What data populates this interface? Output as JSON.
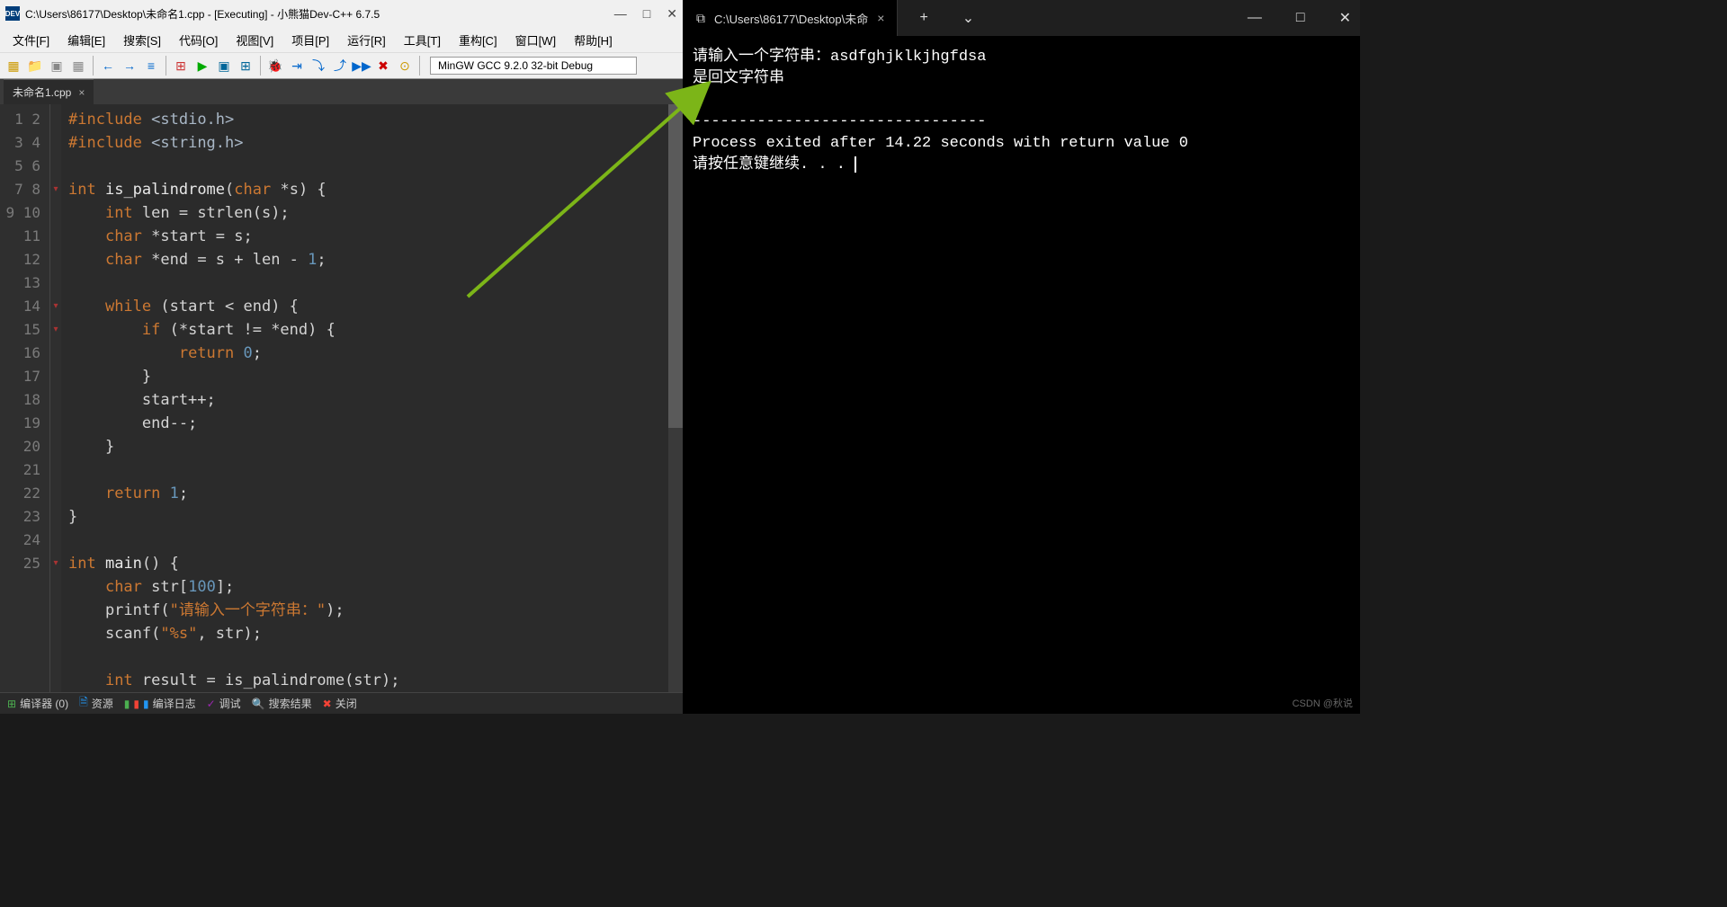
{
  "ide": {
    "title": "C:\\Users\\86177\\Desktop\\未命名1.cpp - [Executing] - 小熊猫Dev-C++ 6.7.5",
    "menus": [
      "文件[F]",
      "编辑[E]",
      "搜索[S]",
      "代码[O]",
      "视图[V]",
      "项目[P]",
      "运行[R]",
      "工具[T]",
      "重构[C]",
      "窗口[W]",
      "帮助[H]"
    ],
    "compiler": "MinGW GCC 9.2.0 32-bit Debug",
    "file_tab": "未命名1.cpp",
    "status": {
      "compiler_tab": "编译器 (0)",
      "resource_tab": "资源",
      "compile_log_tab": "编译日志",
      "debug_tab": "调试",
      "search_result_tab": "搜索结果",
      "close_tab": "关闭"
    },
    "code_lines": [
      {
        "n": 1,
        "html": "<span class='inc'>#include</span> <span class='hdr'>&lt;stdio.h&gt;</span>"
      },
      {
        "n": 2,
        "html": "<span class='inc'>#include</span> <span class='hdr'>&lt;string.h&gt;</span>"
      },
      {
        "n": 3,
        "html": ""
      },
      {
        "n": 4,
        "html": "<span class='type'>int</span> <span class='fn'>is_palindrome</span>(<span class='type'>char</span> *s) {",
        "fold": true
      },
      {
        "n": 5,
        "html": "    <span class='type'>int</span> len = strlen(s);"
      },
      {
        "n": 6,
        "html": "    <span class='type'>char</span> *start = s;"
      },
      {
        "n": 7,
        "html": "    <span class='type'>char</span> *end = s + len - <span class='num'>1</span>;"
      },
      {
        "n": 8,
        "html": ""
      },
      {
        "n": 9,
        "html": "    <span class='kw'>while</span> (start &lt; end) {",
        "fold": true
      },
      {
        "n": 10,
        "html": "        <span class='kw'>if</span> (*start != *end) {",
        "fold": true
      },
      {
        "n": 11,
        "html": "            <span class='kw'>return</span> <span class='num'>0</span>;"
      },
      {
        "n": 12,
        "html": "        }"
      },
      {
        "n": 13,
        "html": "        start++;"
      },
      {
        "n": 14,
        "html": "        end--;"
      },
      {
        "n": 15,
        "html": "    }"
      },
      {
        "n": 16,
        "html": ""
      },
      {
        "n": 17,
        "html": "    <span class='kw'>return</span> <span class='num'>1</span>;"
      },
      {
        "n": 18,
        "html": "}"
      },
      {
        "n": 19,
        "html": ""
      },
      {
        "n": 20,
        "html": "<span class='type'>int</span> <span class='fn'>main</span>() {",
        "fold": true
      },
      {
        "n": 21,
        "html": "    <span class='type'>char</span> str[<span class='num'>100</span>];"
      },
      {
        "n": 22,
        "html": "    printf(<span class='str'>\"请输入一个字符串：\"</span>);"
      },
      {
        "n": 23,
        "html": "    scanf(<span class='str'>\"%s\"</span>, str);"
      },
      {
        "n": 24,
        "html": ""
      },
      {
        "n": 25,
        "html": "    <span class='type'>int</span> result = is_palindrome(str);"
      }
    ]
  },
  "terminal": {
    "tab_title": "C:\\Users\\86177\\Desktop\\未命",
    "lines": [
      "请输入一个字符串：asdfghjklkjhgfdsa",
      "是回文字符串",
      "",
      "--------------------------------",
      "Process exited after 14.22 seconds with return value 0",
      "请按任意键继续. . . "
    ]
  },
  "watermark": "CSDN @秋说"
}
